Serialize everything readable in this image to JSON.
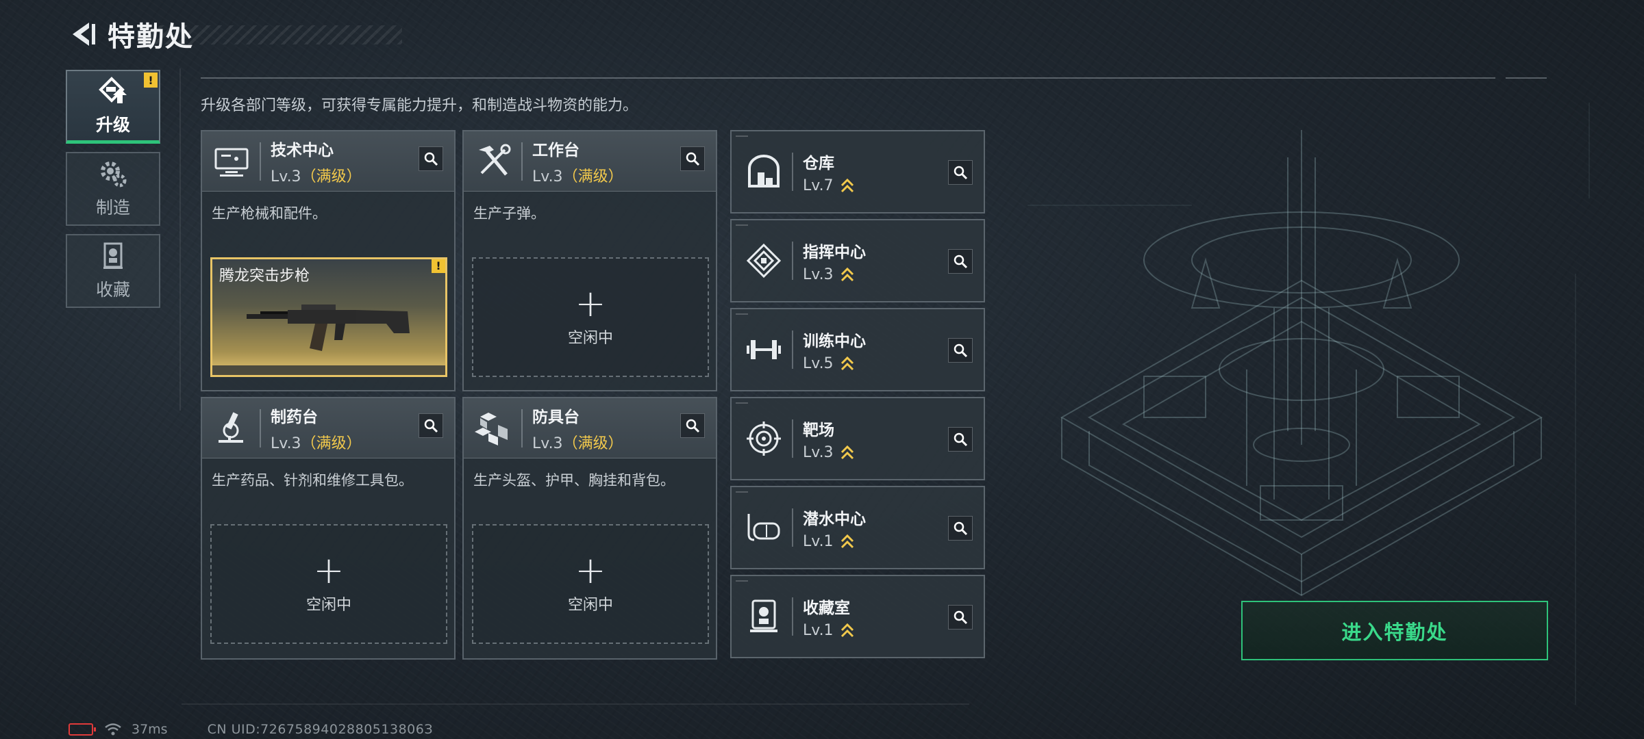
{
  "header": {
    "title": "特勤处"
  },
  "nav": {
    "items": [
      {
        "label": "升级",
        "icon": "upgrade-icon",
        "active": true,
        "badge": "!"
      },
      {
        "label": "制造",
        "icon": "gears-icon",
        "active": false
      },
      {
        "label": "收藏",
        "icon": "collection-icon",
        "active": false
      }
    ]
  },
  "description": "升级各部门等级，可获得专属能力提升，和制造战斗物资的能力。",
  "cards": [
    {
      "name": "技术中心",
      "level": "Lv.3",
      "max_label": "（满级）",
      "desc": "生产枪械和配件。",
      "producing": "腾龙突击步枪",
      "badge": "!"
    },
    {
      "name": "工作台",
      "level": "Lv.3",
      "max_label": "（满级）",
      "desc": "生产子弹。",
      "slot_label": "空闲中",
      "slot_plus": "+"
    },
    {
      "name": "制药台",
      "level": "Lv.3",
      "max_label": "（满级）",
      "desc": "生产药品、针剂和维修工具包。",
      "slot_label": "空闲中",
      "slot_plus": "+"
    },
    {
      "name": "防具台",
      "level": "Lv.3",
      "max_label": "（满级）",
      "desc": "生产头盔、护甲、胸挂和背包。",
      "slot_label": "空闲中",
      "slot_plus": "+"
    }
  ],
  "list": [
    {
      "name": "仓库",
      "level": "Lv.7",
      "icon": "warehouse-icon"
    },
    {
      "name": "指挥中心",
      "level": "Lv.3",
      "icon": "command-icon"
    },
    {
      "name": "训练中心",
      "level": "Lv.5",
      "icon": "dumbbell-icon"
    },
    {
      "name": "靶场",
      "level": "Lv.3",
      "icon": "target-icon"
    },
    {
      "name": "潜水中心",
      "level": "Lv.1",
      "icon": "diving-mask-icon"
    },
    {
      "name": "收藏室",
      "level": "Lv.1",
      "icon": "collection-room-icon"
    }
  ],
  "enter_button": "进入特勤处",
  "status": {
    "ping": "37ms",
    "uid": "CN UID:7267589402880513806З"
  },
  "colors": {
    "accent_green": "#2ec37a",
    "gold": "#f2c94c",
    "warning": "#f1c232"
  }
}
